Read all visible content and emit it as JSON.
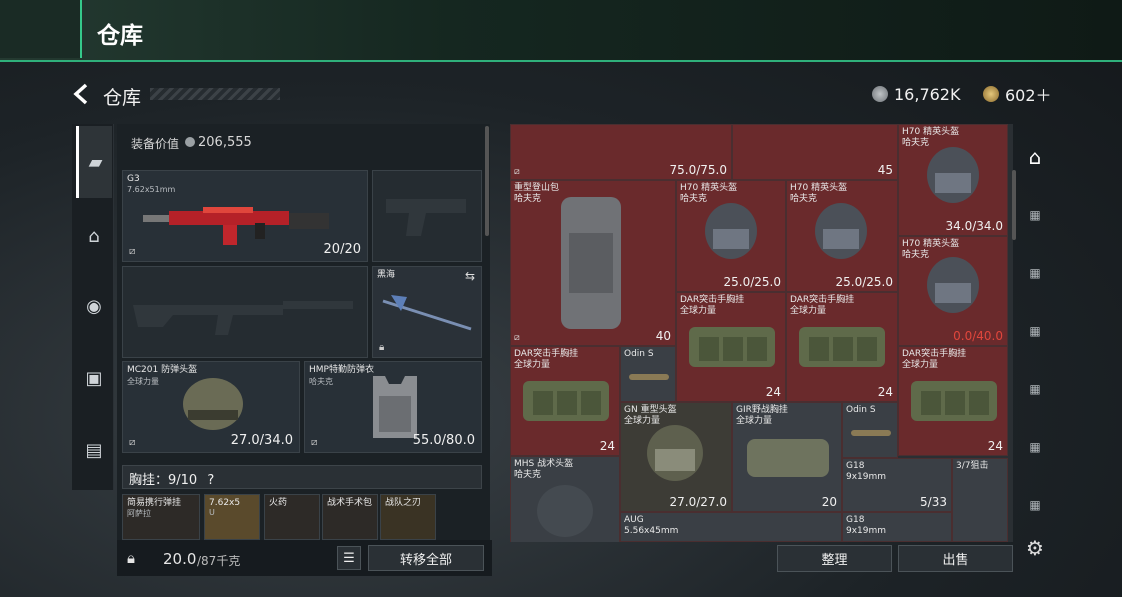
{
  "banner": {
    "title": "仓库"
  },
  "header": {
    "title": "仓库",
    "silver": "16,762K",
    "gold": "602＋"
  },
  "loadout": {
    "equip_value_label": "装备价值",
    "equip_value": "206,555",
    "primary": {
      "name": "G3",
      "caliber": "7.62x51mm",
      "durability": "20/20"
    },
    "melee": {
      "name": "黑海"
    },
    "helmet": {
      "name": "MC201 防弹头盔",
      "maker": "全球力量",
      "durability": "27.0/34.0"
    },
    "armor": {
      "name": "HMP特勤防弹衣",
      "maker": "哈夫克",
      "durability": "55.0/80.0"
    },
    "chest": {
      "label": "胸挂：9/10",
      "help": "?"
    },
    "pockets": [
      {
        "name": "简易携行弹挂",
        "sub": "阿萨拉"
      },
      {
        "name": "7.62x5",
        "sub": "U"
      },
      {
        "name": "火药",
        "sub": ""
      },
      {
        "name": "战术手术包",
        "sub": ""
      },
      {
        "name": "战队之刃",
        "sub": ""
      }
    ],
    "weight": "20.0",
    "weight_max": "/87千克",
    "transfer_all": "转移全部"
  },
  "stash": {
    "items": [
      {
        "name": "",
        "sub": "",
        "dur": "75.0/75.0"
      },
      {
        "name": "",
        "sub": "",
        "dur": "45"
      },
      {
        "name": "H70 精英头盔",
        "sub": "哈夫克",
        "dur": "34.0/34.0"
      },
      {
        "name": "重型登山包",
        "sub": "哈夫克",
        "dur": "40"
      },
      {
        "name": "H70 精英头盔",
        "sub": "哈夫克",
        "dur": "25.0/25.0"
      },
      {
        "name": "H70 精英头盔",
        "sub": "哈夫克",
        "dur": "25.0/25.0"
      },
      {
        "name": "H70 精英头盔",
        "sub": "哈夫克",
        "dur": "0.0/40.0"
      },
      {
        "name": "DAR突击手胸挂",
        "sub": "全球力量",
        "dur": "24"
      },
      {
        "name": "DAR突击手胸挂",
        "sub": "全球力量",
        "dur": "24"
      },
      {
        "name": "DAR突击手胸挂",
        "sub": "全球力量",
        "dur": "24"
      },
      {
        "name": "Odin S",
        "sub": "",
        "dur": ""
      },
      {
        "name": "DAR突击手胸挂",
        "sub": "全球力量",
        "dur": "24"
      },
      {
        "name": "GN 重型头盔",
        "sub": "全球力量",
        "dur": "27.0/27.0"
      },
      {
        "name": "GIR野战胸挂",
        "sub": "全球力量",
        "dur": "20"
      },
      {
        "name": "Odin S",
        "sub": "",
        "dur": ""
      },
      {
        "name": "MHS 战术头盔",
        "sub": "哈夫克",
        "dur": ""
      },
      {
        "name": "G18",
        "sub": "9x19mm",
        "dur": "5/33"
      },
      {
        "name": "3/7狙击",
        "sub": "",
        "dur": ""
      },
      {
        "name": "AUG",
        "sub": "5.56x45mm",
        "dur": ""
      },
      {
        "name": "G18",
        "sub": "9x19mm",
        "dur": ""
      }
    ],
    "sort": "整理",
    "sell": "出售"
  },
  "colors": {
    "accent": "#2fb07b",
    "stash_red": "#6a2a2c",
    "stash_dark": "#3a3f45",
    "warn": "#e0463c"
  }
}
